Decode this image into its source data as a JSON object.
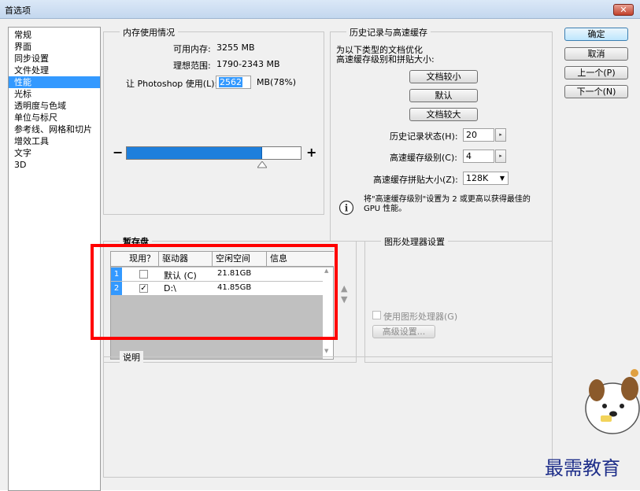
{
  "window": {
    "title": "首选项",
    "close_label": "✕"
  },
  "nav": {
    "items": [
      {
        "label": "常规",
        "selected": false
      },
      {
        "label": "界面",
        "selected": false
      },
      {
        "label": "同步设置",
        "selected": false
      },
      {
        "label": "文件处理",
        "selected": false
      },
      {
        "label": "性能",
        "selected": true
      },
      {
        "label": "光标",
        "selected": false
      },
      {
        "label": "透明度与色域",
        "selected": false
      },
      {
        "label": "单位与标尺",
        "selected": false
      },
      {
        "label": "参考线、网格和切片",
        "selected": false
      },
      {
        "label": "增效工具",
        "selected": false
      },
      {
        "label": "文字",
        "selected": false
      },
      {
        "label": "3D",
        "selected": false
      }
    ]
  },
  "memory": {
    "title": "内存使用情况",
    "available_label": "可用内存:",
    "available_value": "3255 MB",
    "ideal_label": "理想范围:",
    "ideal_value": "1790-2343 MB",
    "let_label": "让 Photoshop 使用(L):",
    "let_value": "2562",
    "let_unit": "MB(78%)",
    "minus": "−",
    "plus": "+",
    "usage_fraction": 0.78
  },
  "history": {
    "title": "历史记录与高速缓存",
    "desc_line1": "为以下类型的文档优化",
    "desc_line2": "高速缓存级别和拼贴大小:",
    "btn_small": "文档较小",
    "btn_default": "默认",
    "btn_large": "文档较大",
    "states_label": "历史记录状态(H):",
    "states_value": "20",
    "cache_levels_label": "高速缓存级别(C):",
    "cache_levels_value": "4",
    "tile_size_label": "高速缓存拼贴大小(Z):",
    "tile_size_value": "128K",
    "info_line1": "将\"高速缓存级别\"设置为 2 或更高以获得最佳的",
    "info_line2": "GPU 性能。"
  },
  "buttons": {
    "ok": "确定",
    "cancel": "取消",
    "prev": "上一个(P)",
    "next": "下一个(N)"
  },
  "scratch": {
    "title": "暂存盘",
    "headers": [
      "现用？",
      "驱动器",
      "空闲空间",
      "信息"
    ],
    "rows": [
      {
        "num": "1",
        "active": false,
        "drive": "默认 (C)",
        "free": "21.81GB",
        "info": ""
      },
      {
        "num": "2",
        "active": true,
        "drive": "D:\\",
        "free": "41.85GB",
        "info": ""
      }
    ],
    "up": "▲",
    "down": "▼"
  },
  "gpu": {
    "title": "图形处理器设置",
    "use_gpu_label": "使用图形处理器(G)",
    "advanced_label": "高级设置..."
  },
  "description": {
    "title": "说明"
  },
  "watermark": {
    "text": "最需教育"
  }
}
